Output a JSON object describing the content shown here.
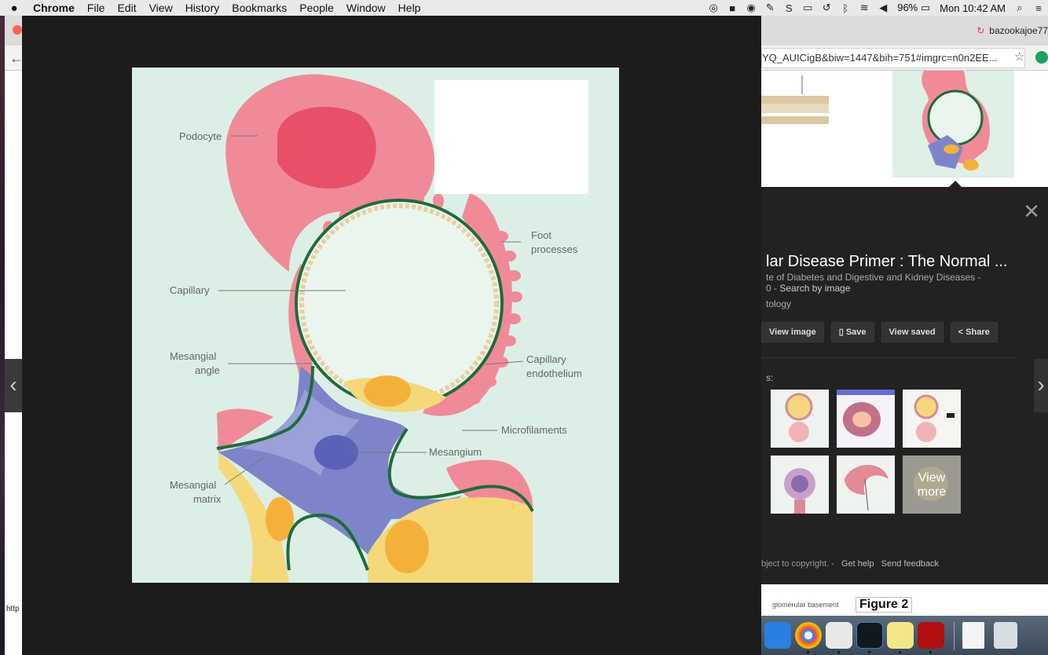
{
  "menubar": {
    "app_name": "Chrome",
    "menus": [
      "File",
      "Edit",
      "View",
      "History",
      "Bookmarks",
      "People",
      "Window",
      "Help"
    ],
    "battery": "96%",
    "clock": "Mon 10:42 AM"
  },
  "browser": {
    "profile_name": "bazookajoe77",
    "url": "YQ_AUICigB&biw=1447&bih=751#imgrc=n0n2EE..."
  },
  "main_image": {
    "labels": {
      "podocyte": "Podocyte",
      "foot_processes_1": "Foot",
      "foot_processes_2": "processes",
      "capillary": "Capillary",
      "mesangial_angle_1": "Mesangial",
      "mesangial_angle_2": "angle",
      "capillary_endothelium_1": "Capillary",
      "capillary_endothelium_2": "endothelium",
      "microfilaments": "Microfilaments",
      "mesangium": "Mesangium",
      "mesangial_matrix_1": "Mesangial",
      "mesangial_matrix_2": "matrix"
    }
  },
  "panel": {
    "title": "lar Disease Primer : The Normal ...",
    "source": "te of Diabetes and Digestive and Kidney Diseases -",
    "meta_prefix": "0 -",
    "search_by_image": "Search by image",
    "topic": "tology",
    "actions": {
      "view_image": "View image",
      "save": "Save",
      "view_saved": "View saved",
      "share": "Share"
    },
    "related_label": "s:",
    "view_more": "View more",
    "footer_text": "bject to copyright. -",
    "get_help": "Get help",
    "send_feedback": "Send feedback"
  },
  "results_bottom": {
    "figure_label": "Figure 2",
    "glomerular_label": "glomerular basement"
  },
  "left_edge": {
    "url_fragment": "http"
  },
  "colors": {
    "podocyte": "#f08a98",
    "nucleus": "#e8506a",
    "membrane": "#1f6b3a",
    "mesangium": "#7e84c9",
    "yellow": "#f4b13a",
    "background": "#dcefe6"
  }
}
